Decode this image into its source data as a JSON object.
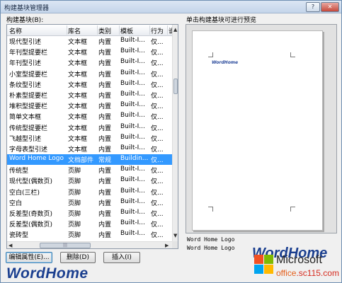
{
  "window": {
    "title": "构建基块管理器",
    "help": "?",
    "close": "✕"
  },
  "list_label": "构建基块(B):",
  "preview_label": "单击构建基块可进行预览",
  "columns": [
    "名称",
    "库名",
    "类别",
    "模板",
    "行为",
    "说"
  ],
  "rows": [
    {
      "name": "现代型引述",
      "lib": "文本框",
      "cat": "内置",
      "tpl": "Built-I...",
      "beh": "仅..."
    },
    {
      "name": "年刊型提要栏",
      "lib": "文本框",
      "cat": "内置",
      "tpl": "Built-I...",
      "beh": "仅..."
    },
    {
      "name": "年刊型引述",
      "lib": "文本框",
      "cat": "内置",
      "tpl": "Built-I...",
      "beh": "仅..."
    },
    {
      "name": "小室型提要栏",
      "lib": "文本框",
      "cat": "内置",
      "tpl": "Built-I...",
      "beh": "仅..."
    },
    {
      "name": "条纹型引述",
      "lib": "文本框",
      "cat": "内置",
      "tpl": "Built-I...",
      "beh": "仅..."
    },
    {
      "name": "朴素型提要栏",
      "lib": "文本框",
      "cat": "内置",
      "tpl": "Built-I...",
      "beh": "仅..."
    },
    {
      "name": "堆积型提要栏",
      "lib": "文本框",
      "cat": "内置",
      "tpl": "Built-I...",
      "beh": "仅..."
    },
    {
      "name": "简单文本框",
      "lib": "文本框",
      "cat": "内置",
      "tpl": "Built-I...",
      "beh": "仅..."
    },
    {
      "name": "传统型提要栏",
      "lib": "文本框",
      "cat": "内置",
      "tpl": "Built-I...",
      "beh": "仅..."
    },
    {
      "name": "飞越型引述",
      "lib": "文本框",
      "cat": "内置",
      "tpl": "Built-I...",
      "beh": "仅..."
    },
    {
      "name": "字母表型引述",
      "lib": "文本框",
      "cat": "内置",
      "tpl": "Built-I...",
      "beh": "仅..."
    },
    {
      "name": "Word Home Logo",
      "lib": "文档部件",
      "cat": "常规",
      "tpl": "Buildin...",
      "beh": "仅...",
      "selected": true
    },
    {
      "name": "传统型",
      "lib": "页脚",
      "cat": "内置",
      "tpl": "Built-I...",
      "beh": "仅..."
    },
    {
      "name": "现代型(偶数页)",
      "lib": "页脚",
      "cat": "内置",
      "tpl": "Built-I...",
      "beh": "仅..."
    },
    {
      "name": "空白(三栏)",
      "lib": "页脚",
      "cat": "内置",
      "tpl": "Built-I...",
      "beh": "仅..."
    },
    {
      "name": "空白",
      "lib": "页脚",
      "cat": "内置",
      "tpl": "Built-I...",
      "beh": "仅..."
    },
    {
      "name": "反差型(奇数页)",
      "lib": "页脚",
      "cat": "内置",
      "tpl": "Built-I...",
      "beh": "仅..."
    },
    {
      "name": "反差型(偶数页)",
      "lib": "页脚",
      "cat": "内置",
      "tpl": "Built-I...",
      "beh": "仅..."
    },
    {
      "name": "瓷砖型",
      "lib": "页脚",
      "cat": "内置",
      "tpl": "Built-I...",
      "beh": "仅..."
    },
    {
      "name": "现代型(奇数页)",
      "lib": "页脚",
      "cat": "内置",
      "tpl": "Built-I...",
      "beh": "仅..."
    }
  ],
  "preview": {
    "page_logo": "WordHome",
    "name": "Word Home Logo",
    "description": "Word Home Logo"
  },
  "buttons": {
    "edit": "编辑属性(E)...",
    "delete": "删除(D)",
    "insert": "插入(I)"
  },
  "watermarks": {
    "left": "WordHome",
    "right": "WordHome",
    "brand": "Microsoft",
    "site_a": "office",
    "site_b": ".sc115.com"
  },
  "colors": {
    "selection": "#3399ff",
    "brand_blue": "#1b3f8f",
    "ms_red": "#f25022",
    "ms_green": "#7fba00",
    "ms_blue": "#00a4ef",
    "ms_yellow": "#ffb900"
  },
  "icons": {
    "scroll_up": "triangle-up",
    "scroll_down": "triangle-down",
    "scroll_left": "triangle-left",
    "scroll_right": "triangle-right"
  }
}
